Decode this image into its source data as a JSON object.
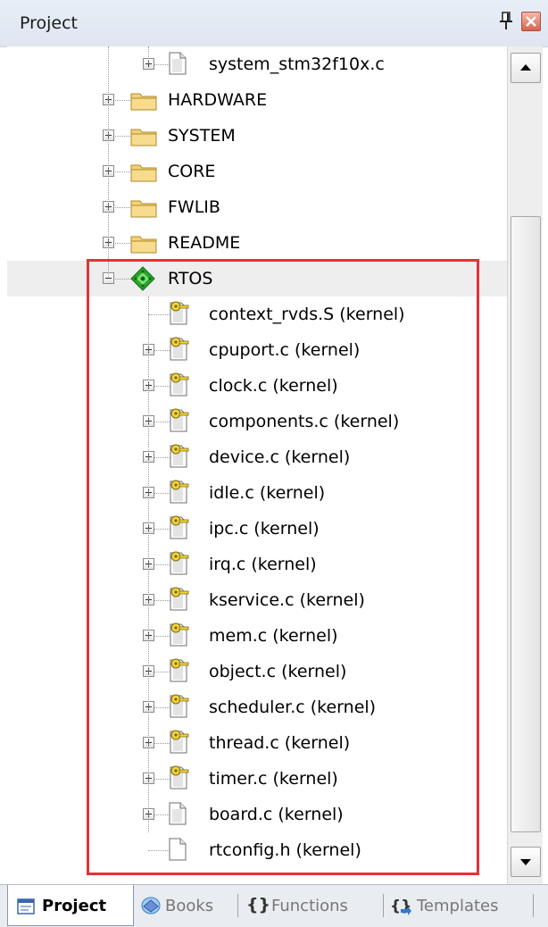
{
  "window": {
    "title": "Project"
  },
  "tree": {
    "rows": [
      {
        "label": "system_stm32f10x.c",
        "icon": "file-icon",
        "expander": "plus",
        "selected": false
      },
      {
        "label": "HARDWARE",
        "icon": "folder-icon",
        "expander": "plus",
        "selected": false
      },
      {
        "label": "SYSTEM",
        "icon": "folder-icon",
        "expander": "plus",
        "selected": false
      },
      {
        "label": "CORE",
        "icon": "folder-icon",
        "expander": "plus",
        "selected": false
      },
      {
        "label": "FWLIB",
        "icon": "folder-icon",
        "expander": "plus",
        "selected": false
      },
      {
        "label": "README",
        "icon": "folder-icon",
        "expander": "plus",
        "selected": false
      },
      {
        "label": "RTOS",
        "icon": "component-group-icon",
        "expander": "minus",
        "selected": true
      },
      {
        "label": "context_rvds.S (kernel)",
        "icon": "locked-file-icon",
        "expander": "none",
        "selected": false
      },
      {
        "label": "cpuport.c (kernel)",
        "icon": "locked-file-icon",
        "expander": "plus",
        "selected": false
      },
      {
        "label": "clock.c (kernel)",
        "icon": "locked-file-icon",
        "expander": "plus",
        "selected": false
      },
      {
        "label": "components.c (kernel)",
        "icon": "locked-file-icon",
        "expander": "plus",
        "selected": false
      },
      {
        "label": "device.c (kernel)",
        "icon": "locked-file-icon",
        "expander": "plus",
        "selected": false
      },
      {
        "label": "idle.c (kernel)",
        "icon": "locked-file-icon",
        "expander": "plus",
        "selected": false
      },
      {
        "label": "ipc.c (kernel)",
        "icon": "locked-file-icon",
        "expander": "plus",
        "selected": false
      },
      {
        "label": "irq.c (kernel)",
        "icon": "locked-file-icon",
        "expander": "plus",
        "selected": false
      },
      {
        "label": "kservice.c (kernel)",
        "icon": "locked-file-icon",
        "expander": "plus",
        "selected": false
      },
      {
        "label": "mem.c (kernel)",
        "icon": "locked-file-icon",
        "expander": "plus",
        "selected": false
      },
      {
        "label": "object.c (kernel)",
        "icon": "locked-file-icon",
        "expander": "plus",
        "selected": false
      },
      {
        "label": "scheduler.c (kernel)",
        "icon": "locked-file-icon",
        "expander": "plus",
        "selected": false
      },
      {
        "label": "thread.c (kernel)",
        "icon": "locked-file-icon",
        "expander": "plus",
        "selected": false
      },
      {
        "label": "timer.c (kernel)",
        "icon": "locked-file-icon",
        "expander": "plus",
        "selected": false
      },
      {
        "label": "board.c (kernel)",
        "icon": "file-icon",
        "expander": "plus",
        "selected": false
      },
      {
        "label": "rtconfig.h (kernel)",
        "icon": "header-file-icon",
        "expander": "none",
        "selected": false
      }
    ]
  },
  "tabs": [
    {
      "label": "Project",
      "icon": "project-tab-icon",
      "active": true
    },
    {
      "label": "Books",
      "icon": "books-tab-icon",
      "active": false
    },
    {
      "label": "Functions",
      "icon": "functions-tab-icon",
      "active": false
    },
    {
      "label": "Templates",
      "icon": "templates-tab-icon",
      "active": false
    }
  ],
  "colors": {
    "highlight_box": "#e5303a",
    "folder": "#f2d27a",
    "component_group": "#2aa52a",
    "selected_row": "#eeeeee",
    "tab_bar": "#e9ecf1"
  }
}
